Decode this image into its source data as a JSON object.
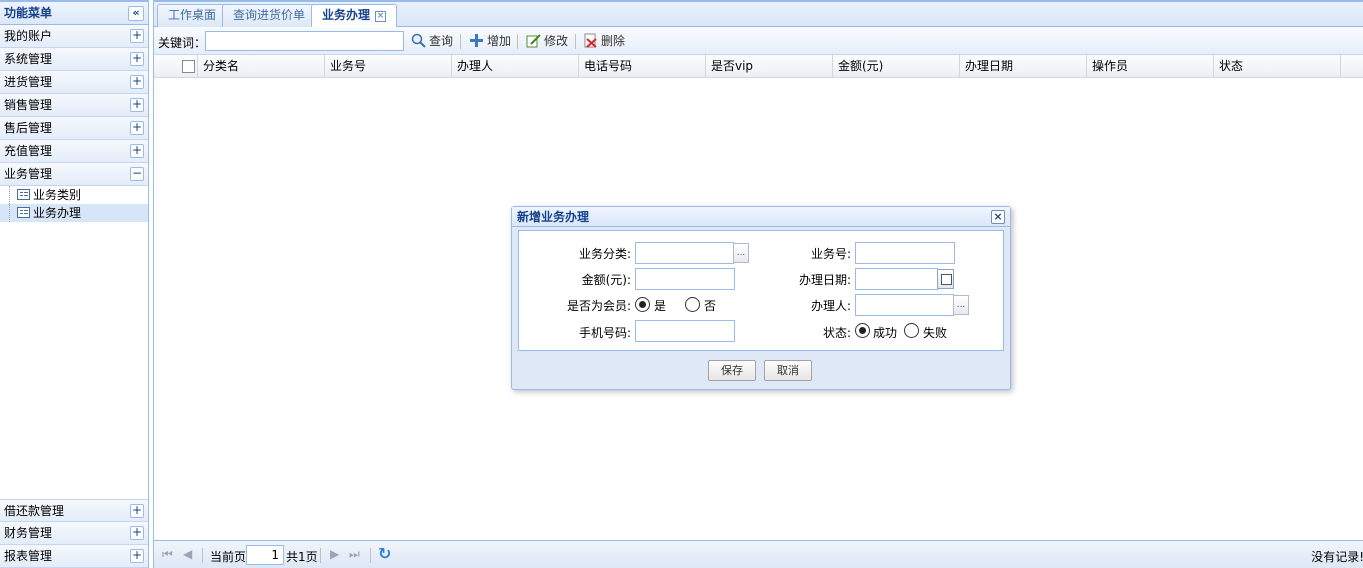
{
  "menu": {
    "title": "功能菜单",
    "collapse_icon": "«",
    "items": [
      {
        "label": "我的账户",
        "icon": "+"
      },
      {
        "label": "系统管理",
        "icon": "+"
      },
      {
        "label": "进货管理",
        "icon": "+"
      },
      {
        "label": "销售管理",
        "icon": "+"
      },
      {
        "label": "售后管理",
        "icon": "+"
      },
      {
        "label": "充值管理",
        "icon": "+"
      },
      {
        "label": "业务管理",
        "icon": "−"
      }
    ],
    "tree": [
      {
        "label": "业务类别"
      },
      {
        "label": "业务办理"
      }
    ],
    "bottom_items": [
      {
        "label": "借还款管理",
        "icon": "+"
      },
      {
        "label": "财务管理",
        "icon": "+"
      },
      {
        "label": "报表管理",
        "icon": "+"
      }
    ]
  },
  "tabs": [
    {
      "label": "工作桌面"
    },
    {
      "label": "查询进货价单"
    },
    {
      "label": "业务办理",
      "close": "×"
    }
  ],
  "toolbar": {
    "keyword_label": "关键词：",
    "keyword_value": "",
    "query": "查询",
    "add": "增加",
    "edit": "修改",
    "delete": "删除"
  },
  "grid": {
    "columns": [
      "分类名",
      "业务号",
      "办理人",
      "电话号码",
      "是否vip",
      "金额(元)",
      "办理日期",
      "操作员",
      "状态"
    ]
  },
  "pager": {
    "current_label": "当前页",
    "page": "1",
    "total": "共1页",
    "no_records": "没有记录!",
    "first": "⏮",
    "prev": "◀",
    "next": "▶",
    "last": "⏭",
    "refresh": "↻"
  },
  "dialog": {
    "title": "新增业务办理",
    "close": "×",
    "fields": {
      "category_label": "业务分类:",
      "biz_no_label": "业务号:",
      "amount_label": "金额(元):",
      "date_label": "办理日期:",
      "member_label": "是否为会员:",
      "member_yes": "是",
      "member_no": "否",
      "handler_label": "办理人:",
      "phone_label": "手机号码:",
      "status_label": "状态:",
      "status_ok": "成功",
      "status_fail": "失败",
      "dots": "..."
    },
    "save": "保存",
    "cancel": "取消"
  }
}
